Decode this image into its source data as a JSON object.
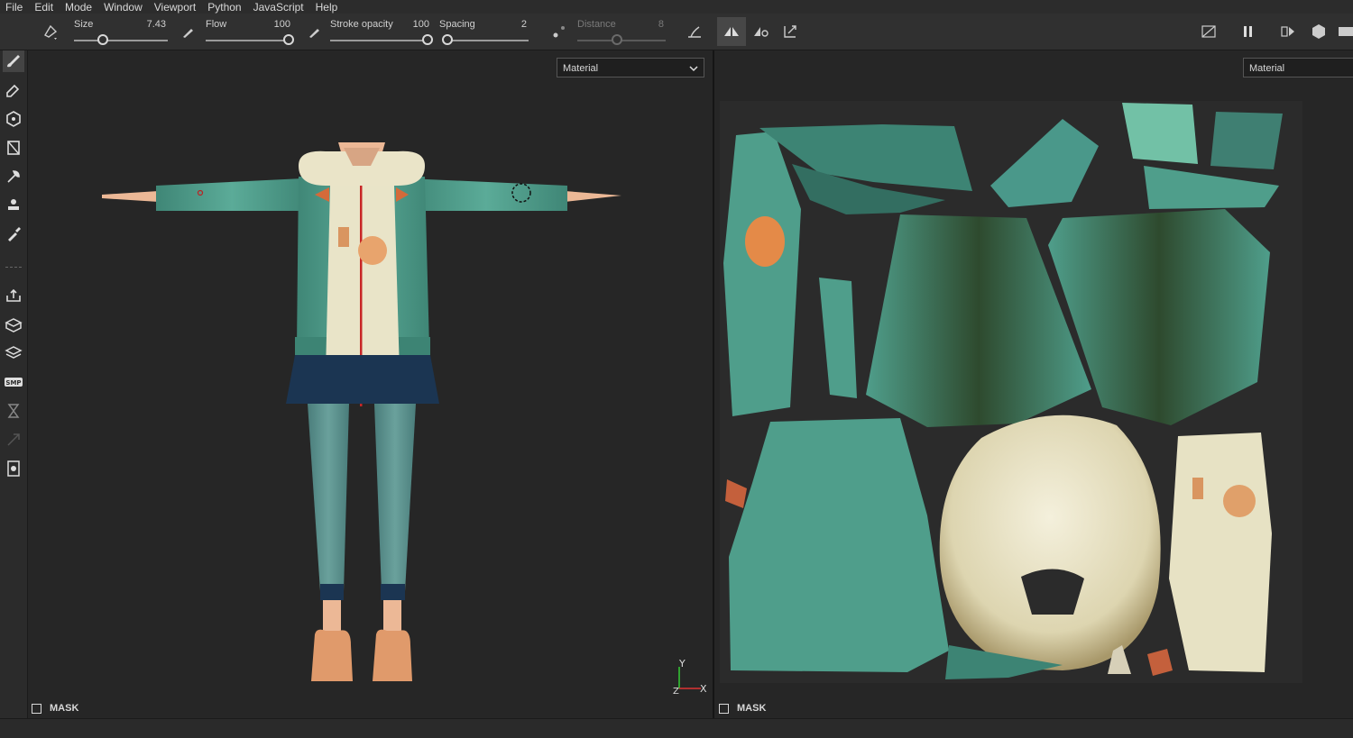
{
  "menu": [
    "File",
    "Edit",
    "Mode",
    "Window",
    "Viewport",
    "Python",
    "JavaScript",
    "Help"
  ],
  "toolbar": {
    "size_label": "Size",
    "size_value": "7.43",
    "flow_label": "Flow",
    "flow_value": "100",
    "opacity_label": "Stroke opacity",
    "opacity_value": "100",
    "spacing_label": "Spacing",
    "spacing_value": "2",
    "distance_label": "Distance",
    "distance_value": "8"
  },
  "viewport_left": {
    "dropdown": "Material",
    "mask_label": "MASK",
    "axis_y": "Y",
    "axis_x": "X"
  },
  "viewport_right": {
    "dropdown": "Material",
    "mask_label": "MASK"
  },
  "colors": {
    "jacket": "#4e9a8a",
    "hood": "#ece7c9",
    "skirt": "#1c3553",
    "leggings": "#5c908c",
    "shoes": "#e09a6b"
  },
  "sidebar_icons": [
    "brush-icon",
    "eraser-icon",
    "projection-icon",
    "polygon-fill-icon",
    "smudge-icon",
    "clone-stamp-icon",
    "color-picker-icon",
    "bake-icon",
    "geometry-icon",
    "material-icon",
    "smp-icon",
    "hourglass-icon",
    "resize-icon",
    "document-icon"
  ]
}
